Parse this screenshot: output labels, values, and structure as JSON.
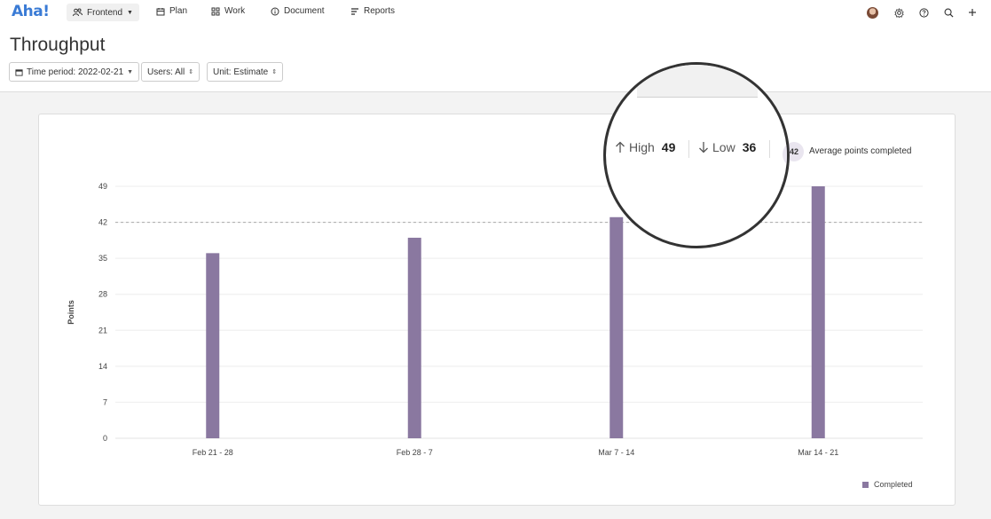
{
  "app": {
    "logo": "Aha!"
  },
  "nav": {
    "workspace": "Frontend",
    "items": [
      "Plan",
      "Work",
      "Document",
      "Reports"
    ]
  },
  "icons": {
    "workspace": "people-icon",
    "plan": "calendar-icon",
    "work": "grid-icon",
    "document": "info-icon",
    "reports": "report-icon",
    "settings": "gear-icon",
    "help": "question-icon",
    "search": "search-icon",
    "add": "plus-icon"
  },
  "page": {
    "title": "Throughput"
  },
  "filters": {
    "time_period": "Time period: 2022-02-21",
    "users": "Users: All",
    "unit": "Unit: Estimate"
  },
  "stats": {
    "high_label": "High",
    "high_value": "49",
    "low_label": "Low",
    "low_value": "36",
    "average_value": "42",
    "average_label": "Average points completed"
  },
  "colors": {
    "bar": "#8a78a0",
    "logo": "#3a7bd5",
    "average_badge": "#e9e5ef"
  },
  "chart_data": {
    "type": "bar",
    "categories": [
      "Feb 21 - 28",
      "Feb 28 - 7",
      "Mar 7 - 14",
      "Mar 14 - 21"
    ],
    "series": [
      {
        "name": "Completed",
        "values": [
          36,
          39,
          43,
          49
        ]
      }
    ],
    "ylabel": "Points",
    "xlabel": "",
    "ylim": [
      0,
      49
    ],
    "yticks": [
      0,
      7,
      14,
      21,
      28,
      35,
      42,
      49
    ],
    "average_line": 42,
    "grid": true,
    "legend_position": "bottom-right"
  }
}
